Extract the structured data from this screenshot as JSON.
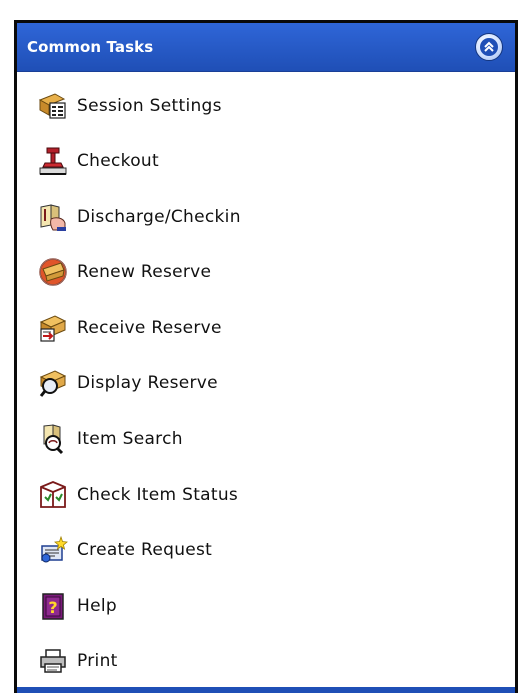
{
  "panel": {
    "title": "Common Tasks",
    "collapse_icon": "double-chevron-up-icon",
    "items": [
      {
        "label": "Session Settings",
        "icon": "session-settings-icon"
      },
      {
        "label": "Checkout",
        "icon": "checkout-stamp-icon"
      },
      {
        "label": "Discharge/Checkin",
        "icon": "discharge-checkin-icon"
      },
      {
        "label": "Renew Reserve",
        "icon": "renew-reserve-icon"
      },
      {
        "label": "Receive Reserve",
        "icon": "receive-reserve-icon"
      },
      {
        "label": "Display Reserve",
        "icon": "display-reserve-icon"
      },
      {
        "label": "Item Search",
        "icon": "item-search-icon"
      },
      {
        "label": "Check Item Status",
        "icon": "check-item-status-icon"
      },
      {
        "label": "Create Request",
        "icon": "create-request-icon"
      },
      {
        "label": "Help",
        "icon": "help-icon"
      },
      {
        "label": "Print",
        "icon": "printer-icon"
      }
    ]
  },
  "colors": {
    "header_blue": "#1f4fb6",
    "header_text": "#ffffff",
    "item_text": "#111111"
  }
}
